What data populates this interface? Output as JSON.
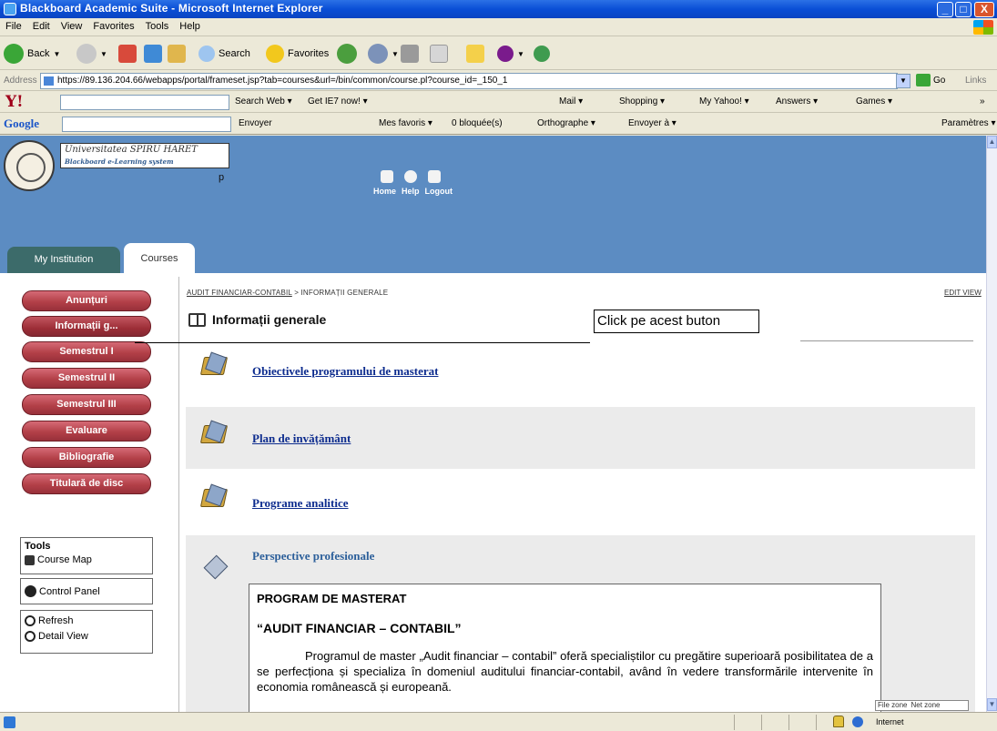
{
  "window": {
    "title": "Blackboard Academic Suite - Microsoft Internet Explorer",
    "min_label": "_",
    "max_label": "□",
    "close_label": "X"
  },
  "menu": [
    "File",
    "Edit",
    "View",
    "Favorites",
    "Tools",
    "Help"
  ],
  "toolbar": {
    "back_label": "Back",
    "search_label": "Search",
    "favorites_label": "Favorites"
  },
  "address": {
    "label": "Address",
    "url": "https://89.136.204.66/webapps/portal/frameset.jsp?tab=courses&url=/bin/common/course.pl?course_id=_150_1",
    "go_label": "Go",
    "links_label": "Links"
  },
  "yahoo_bar": {
    "logo": "Y!",
    "search_web": "Search Web",
    "get_ie7": "Get IE7 now!",
    "mail": "Mail",
    "shopping": "Shopping",
    "my_yahoo": "My Yahoo!",
    "answers": "Answers",
    "games": "Games"
  },
  "google_bar": {
    "logo": "Google",
    "envoyer": "Envoyer",
    "mes_favoris": "Mes favoris",
    "bloquees": "0 bloquée(s)",
    "orthographe": "Orthographe",
    "envoyer_a": "Envoyer à",
    "parametres": "Paramètres"
  },
  "blackboard": {
    "university": "Universitatea SPIRU HARET",
    "system": "Blackboard e-Learning system",
    "p_mark": "p",
    "nav": {
      "home": "Home",
      "help": "Help",
      "logout": "Logout"
    },
    "tabs": {
      "institution": "My Institution",
      "courses": "Courses"
    }
  },
  "left_nav": {
    "buttons": [
      "Anunțuri",
      "Informații g...",
      "Semestrul I",
      "Semestrul II",
      "Semestrul III",
      "Evaluare",
      "Bibliografie",
      "Titulară de disc"
    ],
    "tools_title": "Tools",
    "course_map": "Course Map",
    "control_panel": "Control Panel",
    "refresh": "Refresh",
    "detail_view": "Detail View"
  },
  "content": {
    "breadcrumb_link": "AUDIT FINANCIAR-CONTABIL",
    "breadcrumb_sep": " > ",
    "breadcrumb_current": "INFORMAȚII GENERALE",
    "edit_view": "EDIT VIEW",
    "page_title": "Informații generale",
    "callout": "Click pe acest buton",
    "items": [
      "Obiectivele programului de masterat",
      "Plan de invățământ",
      "Programe analitice",
      "Perspective profesionale"
    ],
    "program_heading": "PROGRAM DE MASTERAT",
    "program_title": "“AUDIT FINANCIAR – CONTABIL”",
    "program_text": "Programul de master „Audit financiar – contabil” oferă specialiștilor cu pregătire superioară posibilitatea de a se perfecționa și specializa în domeniul auditului financiar-contabil, având în vedere transformările intervenite în economia românească și europeană."
  },
  "status": {
    "zone_file": "File zone",
    "zone_net": "Net zone",
    "internet": "Internet"
  }
}
